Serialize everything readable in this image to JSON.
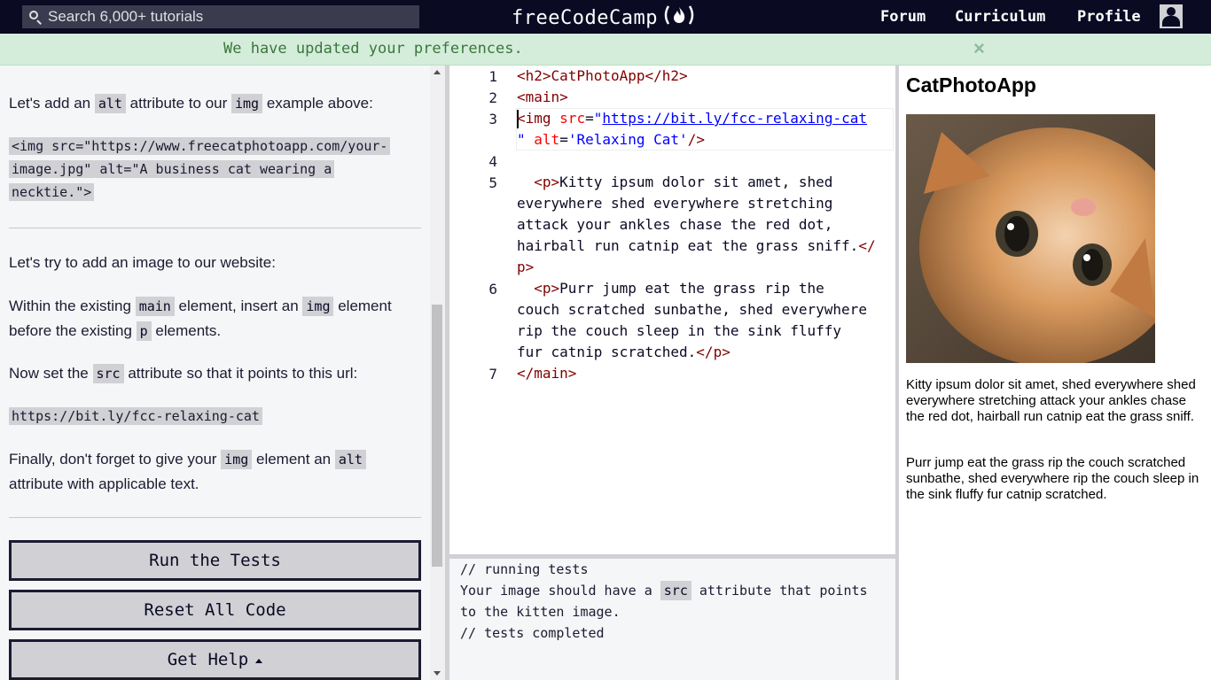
{
  "nav": {
    "search_placeholder": "Search 6,000+ tutorials",
    "logo_text": "freeCodeCamp",
    "links": [
      "Forum",
      "Curriculum",
      "Profile"
    ]
  },
  "flash": {
    "message": "We have updated your preferences.",
    "close": "×"
  },
  "instructions": {
    "p1_pre": "Let's add an ",
    "p1_code1": "alt",
    "p1_mid": " attribute to our ",
    "p1_code2": "img",
    "p1_post": " example above:",
    "example_code": [
      "<img src=\"https://www.freecatphotoapp.com/your-",
      "image.jpg\" alt=\"A business cat wearing a",
      "necktie.\">"
    ],
    "p2": "Let's try to add an image to our website:",
    "p3_pre": "Within the existing ",
    "p3_code1": "main",
    "p3_mid": " element, insert an ",
    "p3_code2": "img",
    "p3_post1": " element before the existing ",
    "p3_code3": "p",
    "p3_post2": " elements.",
    "p4_pre": "Now set the ",
    "p4_code": "src",
    "p4_post": " attribute so that it points to this url:",
    "url_code": "https://bit.ly/fcc-relaxing-cat",
    "p5_pre": "Finally, don't forget to give your ",
    "p5_code1": "img",
    "p5_mid": " element an ",
    "p5_code2": "alt",
    "p5_post": " attribute with applicable text."
  },
  "buttons": {
    "run": "Run the Tests",
    "reset": "Reset All Code",
    "help": "Get Help"
  },
  "editor": {
    "line_numbers": [
      "1",
      "2",
      "3",
      "4",
      "5",
      "6",
      "7"
    ],
    "line1": "<h2>CatPhotoApp</h2>",
    "line2": "<main>",
    "line3_url": "https://bit.ly/fcc-relaxing-cat",
    "line3_alt": "'Relaxing Cat'",
    "line5_text": [
      "Kitty ipsum dolor sit amet, shed",
      "everywhere shed everywhere stretching",
      "attack your ankles chase the red dot,",
      "hairball run catnip eat the grass sniff."
    ],
    "line6_text": [
      "Purr jump eat the grass rip the",
      "couch scratched sunbathe, shed everywhere",
      "rip the couch sleep in the sink fluffy",
      "fur catnip scratched."
    ],
    "line7": "</main>"
  },
  "console": {
    "line1": "// running tests",
    "line2_pre": "Your image should have a ",
    "line2_code": "src",
    "line2_post": " attribute that points",
    "line3": "to the kitten image.",
    "line4": "// tests completed"
  },
  "preview": {
    "title": "CatPhotoApp",
    "p1": "Kitty ipsum dolor sit amet, shed everywhere shed everywhere stretching attack your ankles chase the red dot, hairball run catnip eat the grass sniff.",
    "p2": "Purr jump eat the grass rip the couch scratched sunbathe, shed everywhere rip the couch sleep in the sink fluffy fur catnip scratched."
  }
}
